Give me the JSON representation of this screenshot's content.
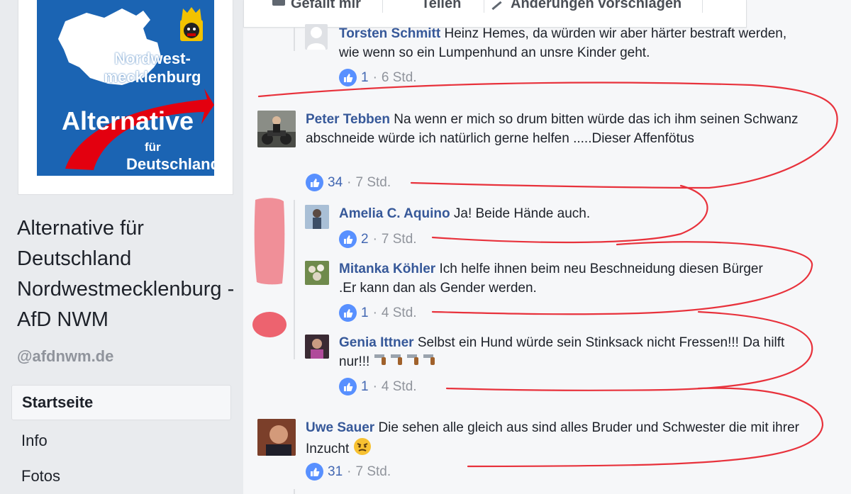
{
  "page": {
    "name": "Alternative für Deutschland Nordwestmecklenburg - AfD NWM",
    "handle": "@afdnwm.de",
    "logo": {
      "region": "Nordwest-\nmecklenburg",
      "brand_line1": "Alternative",
      "brand_line2": "für",
      "brand_line3": "Deutschland",
      "colors": {
        "background": "#1b64b3",
        "arrow": "#e3000f"
      }
    }
  },
  "nav": {
    "items": [
      {
        "label": "Startseite",
        "active": true
      },
      {
        "label": "Info",
        "active": false
      },
      {
        "label": "Fotos",
        "active": false
      }
    ]
  },
  "actions": {
    "comment_label": "Gefällt mir",
    "share_label": "Teilen",
    "suggest_label": "Änderungen vorschlagen"
  },
  "comments": [
    {
      "author": "Torsten Schmitt",
      "text": "Heinz Hemes, da würden wir aber härter bestraft werden, wie wenn so ein Lumpenhund an unsre Kinder geht.",
      "likes": "1",
      "time": "6 Std."
    },
    {
      "author": "Peter Tebben",
      "text": "Na wenn er mich so drum bitten würde das ich ihm seinen Schwanz abschneide würde ich natürlich gerne helfen .....Dieser Affenfötus",
      "likes": "34",
      "time": "7 Std."
    },
    {
      "author": "Amelia C. Aquino",
      "text": "Ja! Beide Hände auch.",
      "likes": "2",
      "time": "7 Std."
    },
    {
      "author": "Mitanka Köhler",
      "text": "Ich helfe ihnen beim neu Beschneidung diesen Bürger .Er kann dan als Gender werden.",
      "likes": "1",
      "time": "4 Std."
    },
    {
      "author": "Genia Ittner",
      "text": "Selbst ein Hund würde sein Stinksack nicht Fressen!!! Da hilft nur!!!",
      "likes": "1",
      "time": "4 Std."
    },
    {
      "author": "Uwe Sauer",
      "text": "Die sehen alle gleich aus sind alles Bruder und Schwester die mit ihrer Inzucht",
      "likes": "31",
      "time": "7 Std."
    }
  ],
  "separator": "·",
  "icons": {
    "like": "thumbs-up-icon",
    "gun": "pistol-emoji",
    "angry": "angry-face-emoji"
  },
  "colors": {
    "link": "#365899",
    "like_blue": "#5890ff",
    "annotation_red": "#e8323c"
  }
}
